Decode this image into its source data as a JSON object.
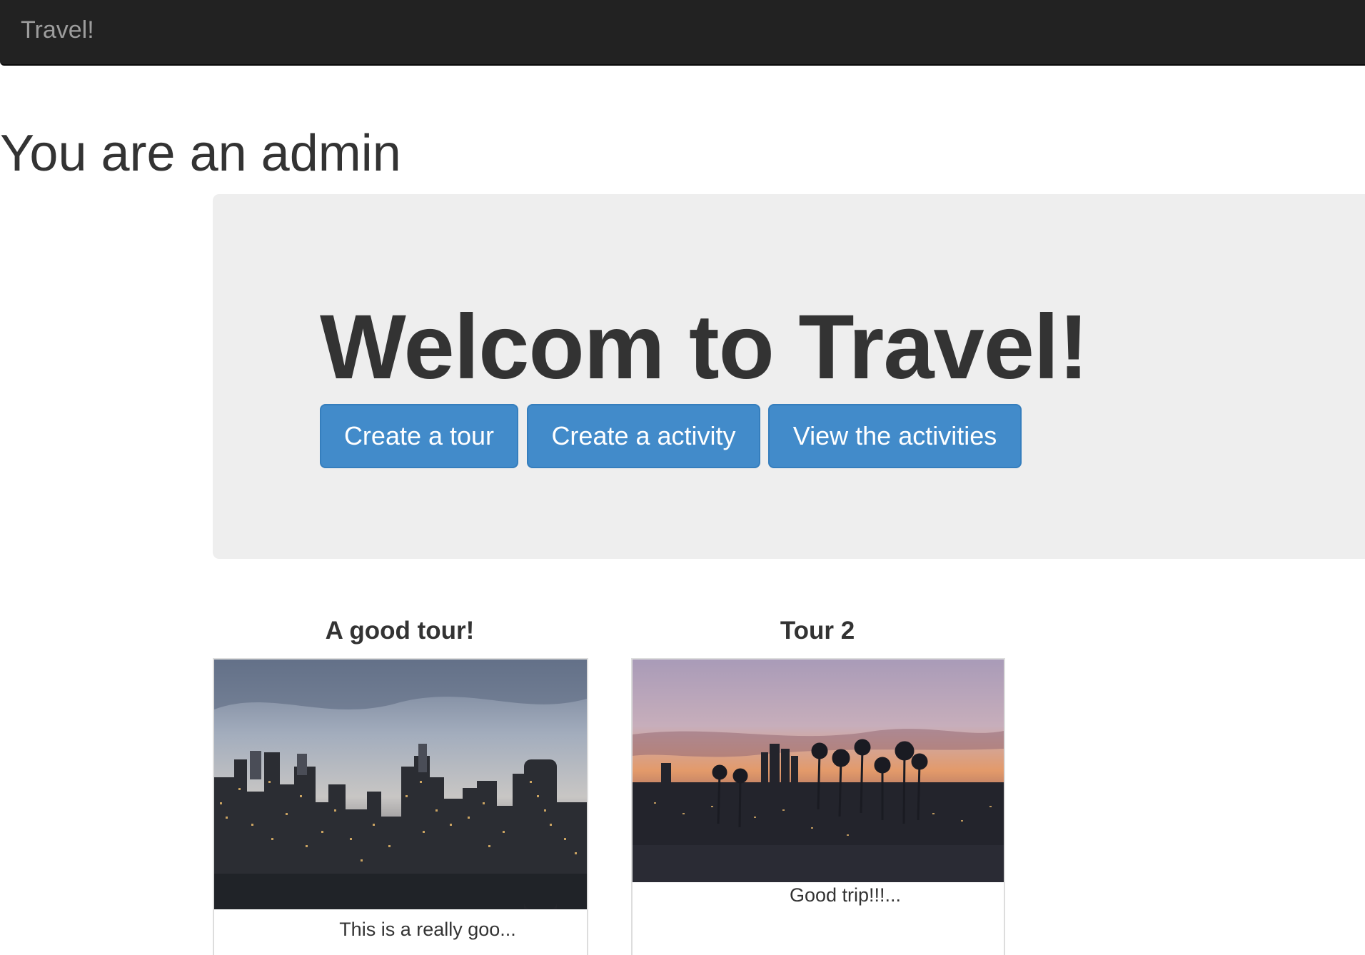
{
  "navbar": {
    "brand": "Travel!"
  },
  "admin_heading": "You are an admin",
  "jumbotron": {
    "title": "Welcom to Travel!",
    "buttons": {
      "create_tour": "Create a tour",
      "create_activity": "Create a activity",
      "view_activities": "View the activities"
    }
  },
  "tours": [
    {
      "title": "A good tour!",
      "description": "This is a really goo...",
      "image": "city-skyline-at-dusk"
    },
    {
      "title": "Tour 2",
      "description": "Good trip!!!...",
      "image": "city-sunset-with-palm-trees"
    }
  ],
  "colors": {
    "navbar": "#222222",
    "brand": "#9d9d9d",
    "jumbotron": "#eeeeee",
    "primary_button": "#428bca"
  }
}
